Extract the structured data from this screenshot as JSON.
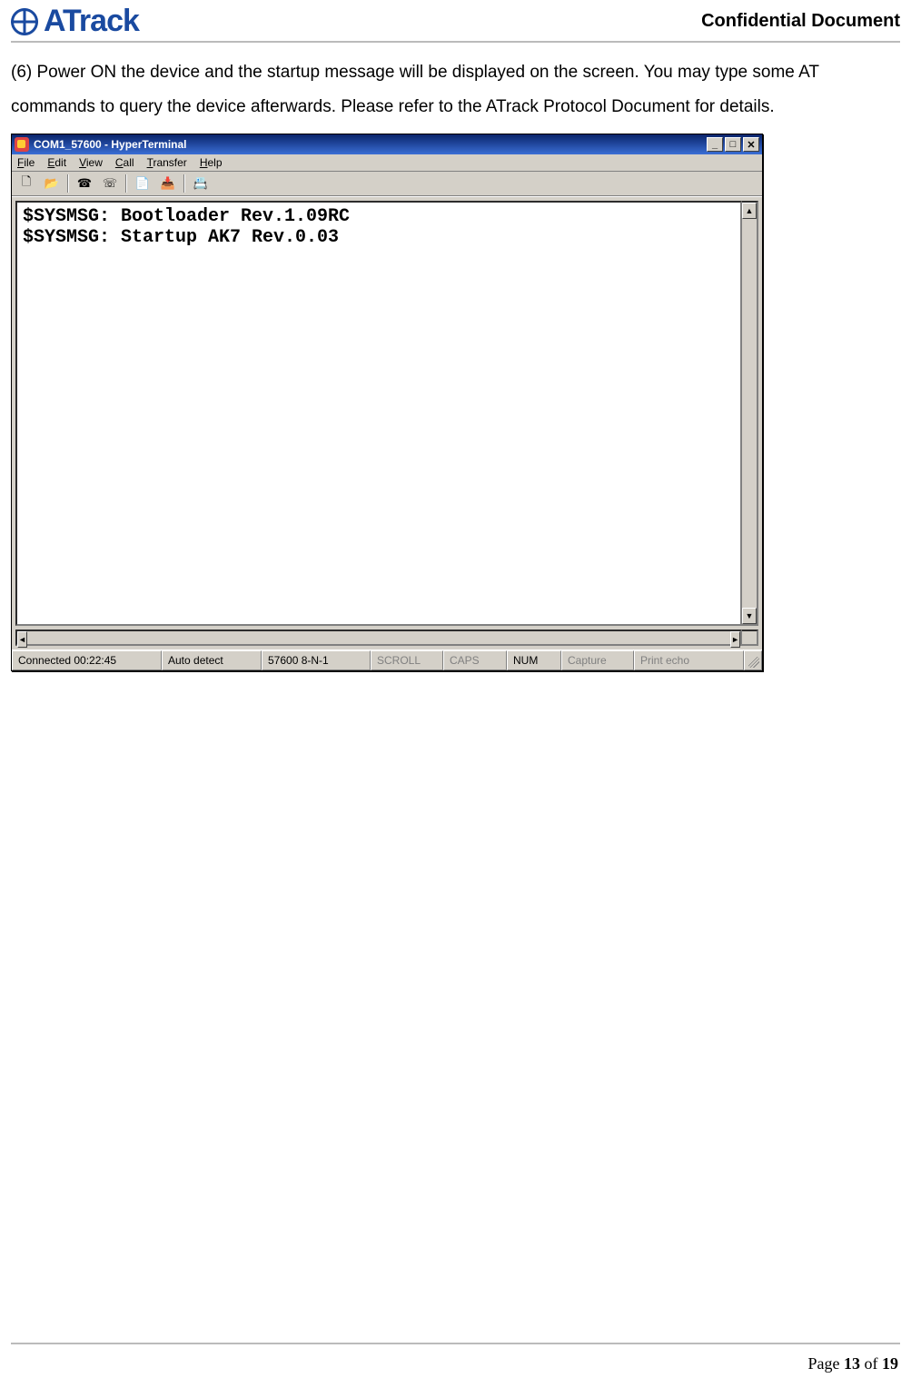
{
  "header": {
    "brand": "ATrack",
    "confidential": "Confidential  Document"
  },
  "body": {
    "paragraph": "(6) Power ON the device and the startup message will be displayed on the screen. You may type some AT commands to query the device afterwards. Please refer to the ATrack Protocol Document for details."
  },
  "hyperterminal": {
    "title": "COM1_57600 - HyperTerminal",
    "menu": {
      "file": "File",
      "edit": "Edit",
      "view": "View",
      "call": "Call",
      "transfer": "Transfer",
      "help": "Help"
    },
    "toolbar_icons": {
      "new": "🗋",
      "open": "📂",
      "call": "☎",
      "hangup": "☏",
      "send": "📄",
      "receive": "📥",
      "properties": "📇"
    },
    "terminal_lines": [
      "$SYSMSG: Bootloader Rev.1.09RC",
      "$SYSMSG: Startup AK7 Rev.0.03"
    ],
    "status": {
      "connected": "Connected 00:22:45",
      "autodetect": "Auto detect",
      "baud": "57600 8-N-1",
      "scroll": "SCROLL",
      "caps": "CAPS",
      "num": "NUM",
      "capture": "Capture",
      "printecho": "Print echo"
    },
    "window_buttons": {
      "min": "_",
      "max": "□",
      "close": "✕"
    },
    "scroll_arrows": {
      "up": "▲",
      "down": "▼",
      "left": "◄",
      "right": "►"
    }
  },
  "footer": {
    "prefix": "Page ",
    "current": "13",
    "of": " of ",
    "total": "19"
  }
}
